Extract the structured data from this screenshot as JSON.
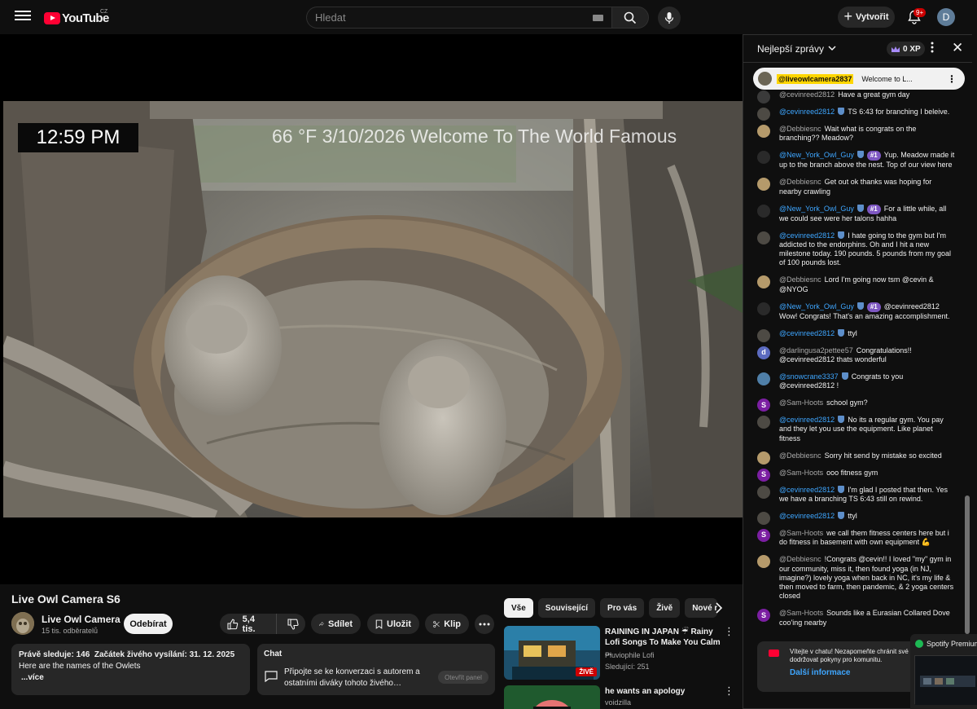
{
  "header": {
    "logo_text": "YouTube",
    "country_code": "CZ",
    "search_placeholder": "Hledat",
    "create_label": "Vytvořit",
    "notifications_count": "9+",
    "avatar_letter": "D"
  },
  "player": {
    "clock_overlay": "12:59 PM",
    "info_overlay": "66 °F 3/10/2026 Welcome To The World Famous"
  },
  "video": {
    "title": "Live Owl Camera S6",
    "channel_name": "Live Owl Camera",
    "subscribers": "15 tis. odběratelů",
    "subscribe_label": "Odebírat",
    "likes": "5,4 tis.",
    "share_label": "Sdílet",
    "save_label": "Uložit",
    "clip_label": "Klip"
  },
  "description": {
    "watching_label": "Právě sleduje:",
    "watching_count": "146",
    "started_label": "Začátek živého vysílání: 31. 12. 2025",
    "text": "Here are the names of the Owlets",
    "more_label": "...více"
  },
  "chat_card": {
    "title": "Chat",
    "text": "Připojte se ke konverzaci s autorem a ostatními diváky tohoto živého…",
    "open_label": "Otevřít panel"
  },
  "recommendations": {
    "tabs": [
      "Vše",
      "Související",
      "Pro vás",
      "Živě",
      "Nové n"
    ],
    "items": [
      {
        "title": "RAINING IN JAPAN ☔ Rainy Lofi Songs To Make You Calm ...",
        "channel": "Pluviophile Lofi",
        "meta": "Sledující: 251",
        "badge": "ŽIVĚ"
      },
      {
        "title": "he wants an apology",
        "channel": "voidzilla",
        "meta": "",
        "badge": ""
      }
    ]
  },
  "live_chat": {
    "mode_label": "Nejlepší zprávy",
    "xp_label": "0 XP",
    "pinned": {
      "author": "@liveowlcamera2837",
      "text": "Welcome to L..."
    },
    "messages": [
      {
        "author": "@cevinreed2812",
        "text": "Have a great gym day",
        "mod": false,
        "badge": "",
        "avatar_color": "#3a3a3a",
        "avatar_letter": ""
      },
      {
        "author": "@cevinreed2812",
        "text": "TS 6:43 for branching I beleive.",
        "mod": true,
        "badge": "",
        "avatar_color": "#4d4a44",
        "avatar_letter": ""
      },
      {
        "author": "@Debbiesnc",
        "text": "Wait what is congrats on the branching?? Meadow?",
        "mod": false,
        "badge": "",
        "avatar_color": "#b59a6b",
        "avatar_letter": ""
      },
      {
        "author": "@New_York_Owl_Guy",
        "text": "Yup. Meadow made it up to the branch above the nest. Top of our view here",
        "mod": true,
        "badge": "#1",
        "avatar_color": "#2a2a2a",
        "avatar_letter": ""
      },
      {
        "author": "@Debbiesnc",
        "text": "Get out ok thanks was hoping for nearby crawling",
        "mod": false,
        "badge": "",
        "avatar_color": "#b59a6b",
        "avatar_letter": ""
      },
      {
        "author": "@New_York_Owl_Guy",
        "text": "For a little while, all we could see were her talons hahha",
        "mod": true,
        "badge": "#1",
        "avatar_color": "#2a2a2a",
        "avatar_letter": ""
      },
      {
        "author": "@cevinreed2812",
        "text": "I hate going to the gym but I'm addicted to the endorphins. Oh and I hit a new milestone today. 190 pounds. 5 pounds from my goal of 100 pounds lost.",
        "mod": true,
        "badge": "",
        "avatar_color": "#4d4a44",
        "avatar_letter": ""
      },
      {
        "author": "@Debbiesnc",
        "text": "Lord I'm going now tsm @cevin & @NYOG",
        "mod": false,
        "badge": "",
        "avatar_color": "#b59a6b",
        "avatar_letter": ""
      },
      {
        "author": "@New_York_Owl_Guy",
        "text": "@cevinreed2812 Wow! Congrats! That's an amazing accomplishment.",
        "mod": true,
        "badge": "#1",
        "avatar_color": "#2a2a2a",
        "avatar_letter": ""
      },
      {
        "author": "@cevinreed2812",
        "text": "ttyl",
        "mod": true,
        "badge": "",
        "avatar_color": "#4d4a44",
        "avatar_letter": ""
      },
      {
        "author": "@darlingusa2pettee57",
        "text": "Congratulations!! @cevinreed2812 thats wonderful",
        "mod": false,
        "badge": "",
        "avatar_color": "#5c6bc0",
        "avatar_letter": "d"
      },
      {
        "author": "@snowcrane3337",
        "text": "Congrats to you @cevinreed2812 !",
        "mod": true,
        "badge": "",
        "avatar_color": "#4f7fa8",
        "avatar_letter": ""
      },
      {
        "author": "@Sam-Hoots",
        "text": "school gym?",
        "mod": false,
        "badge": "",
        "avatar_color": "#7b1fa2",
        "avatar_letter": "S"
      },
      {
        "author": "@cevinreed2812",
        "text": "No its a regular gym. You pay and they let you use the equipment. Like planet fitness",
        "mod": true,
        "badge": "",
        "avatar_color": "#4d4a44",
        "avatar_letter": ""
      },
      {
        "author": "@Debbiesnc",
        "text": "Sorry hit send by mistake so excited",
        "mod": false,
        "badge": "",
        "avatar_color": "#b59a6b",
        "avatar_letter": ""
      },
      {
        "author": "@Sam-Hoots",
        "text": "ooo fitness gym",
        "mod": false,
        "badge": "",
        "avatar_color": "#7b1fa2",
        "avatar_letter": "S"
      },
      {
        "author": "@cevinreed2812",
        "text": "I'm glad I posted that then. Yes we have a branching TS 6:43 still on rewind.",
        "mod": true,
        "badge": "",
        "avatar_color": "#4d4a44",
        "avatar_letter": ""
      },
      {
        "author": "@cevinreed2812",
        "text": "ttyl",
        "mod": true,
        "badge": "",
        "avatar_color": "#4d4a44",
        "avatar_letter": ""
      },
      {
        "author": "@Sam-Hoots",
        "text": "we call them fitness centers here but i do fitness in basement with own equipment 💪",
        "mod": false,
        "badge": "",
        "avatar_color": "#7b1fa2",
        "avatar_letter": "S"
      },
      {
        "author": "@Debbiesnc",
        "text": "!Congrats @cevin!! I loved \"my\" gym in our community, miss it, then found yoga (in NJ, imagine?) lovely yoga when back in NC, it's my life & then moved to farm, then pandemic, & 2 yoga centers closed",
        "mod": false,
        "badge": "",
        "avatar_color": "#b59a6b",
        "avatar_letter": ""
      },
      {
        "author": "@Sam-Hoots",
        "text": "Sounds like a Eurasian Collared Dove coo'ing nearby",
        "mod": false,
        "badge": "",
        "avatar_color": "#7b1fa2",
        "avatar_letter": "S"
      }
    ],
    "notice_text": "Vítejte v chatu! Nezapomeňte chránit své soukromí a dodržovat pokyny pro komunitu.",
    "notice_link": "Další informace"
  },
  "spotify_popup": {
    "title": "Spotify Premium"
  }
}
